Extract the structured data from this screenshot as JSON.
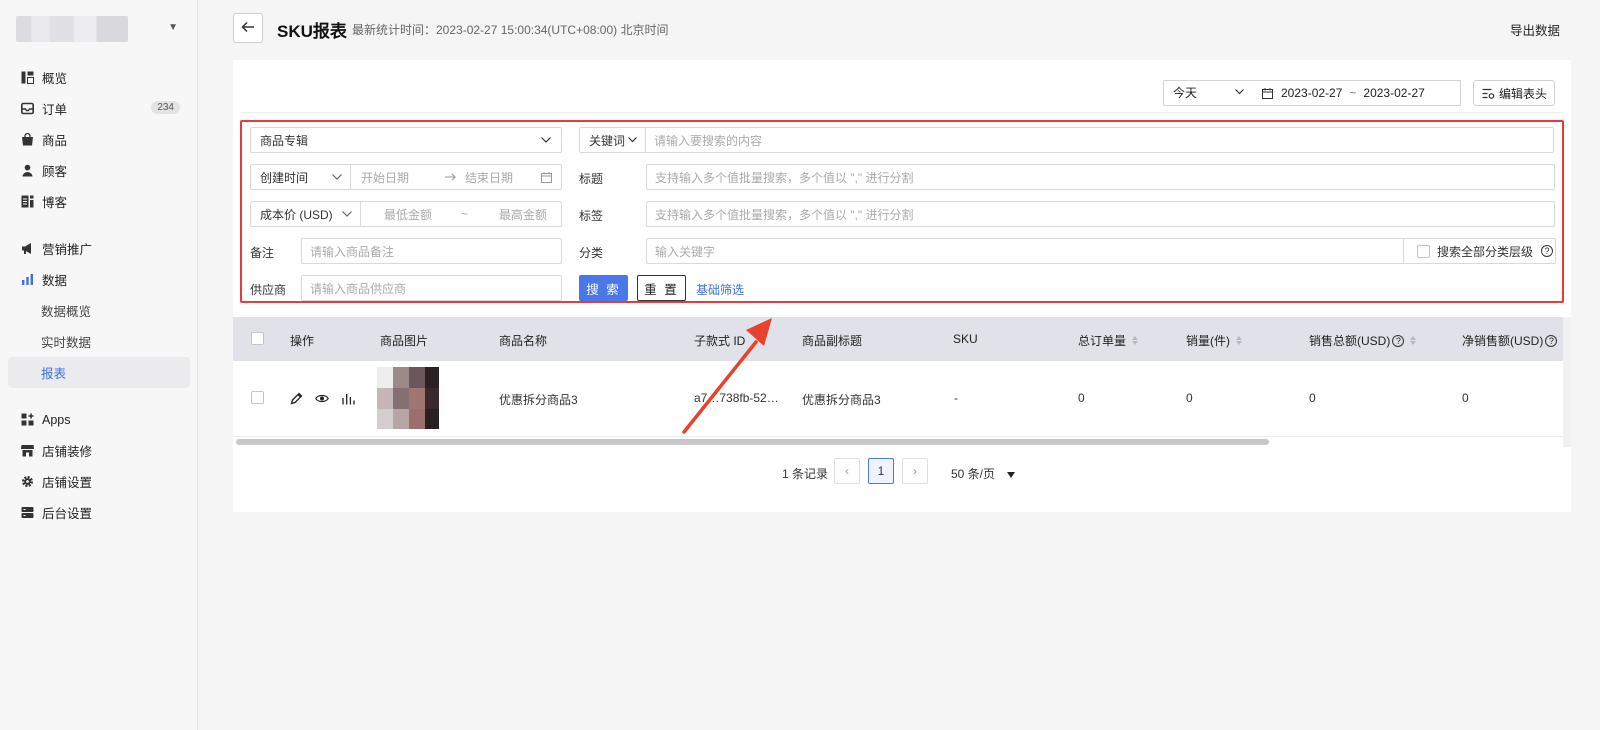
{
  "sidebar": {
    "items": [
      {
        "label": "概览",
        "icon": "overview-icon"
      },
      {
        "label": "订单",
        "icon": "orders-icon",
        "badge": "234"
      },
      {
        "label": "商品",
        "icon": "bag-icon"
      },
      {
        "label": "顾客",
        "icon": "user-icon"
      },
      {
        "label": "博客",
        "icon": "blog-icon"
      }
    ],
    "items2": [
      {
        "label": "营销推广",
        "icon": "megaphone-icon"
      },
      {
        "label": "数据",
        "icon": "bar-chart-icon"
      }
    ],
    "data_sub": [
      "数据概览",
      "实时数据",
      "报表"
    ],
    "items3": [
      {
        "label": "Apps",
        "icon": "apps-icon"
      },
      {
        "label": "店铺装修",
        "icon": "store-icon"
      },
      {
        "label": "店铺设置",
        "icon": "gear-icon"
      },
      {
        "label": "后台设置",
        "icon": "server-icon"
      }
    ]
  },
  "header": {
    "title": "SKU报表",
    "stat_time": "最新统计时间：2023-02-27 15:00:34(UTC+08:00) 北京时间",
    "export": "导出数据"
  },
  "toolbar": {
    "period": "今天",
    "date_start": "2023-02-27",
    "date_sep": "~",
    "date_end": "2023-02-27",
    "edit_columns": "编辑表头"
  },
  "filters": {
    "collection_select": "商品专辑",
    "keyword_select": "关键词",
    "keyword_placeholder": "请输入要搜索的内容",
    "created_select": "创建时间",
    "start_date_placeholder": "开始日期",
    "end_date_placeholder": "结束日期",
    "title_label": "标题",
    "title_placeholder": "支持输入多个值批量搜索，多个值以 \",\" 进行分割",
    "cost_select": "成本价 (USD)",
    "min_amount_placeholder": "最低金额",
    "amount_sep": "~",
    "max_amount_placeholder": "最高金额",
    "tag_label": "标签",
    "tag_placeholder": "支持输入多个值批量搜索，多个值以 \",\" 进行分割",
    "note_label": "备注",
    "note_placeholder": "请输入商品备注",
    "category_label": "分类",
    "category_placeholder": "输入关键字",
    "search_all_levels": "搜索全部分类层级",
    "supplier_label": "供应商",
    "supplier_placeholder": "请输入商品供应商",
    "search_button": "搜 索",
    "reset_button": "重 置",
    "basic_filter_link": "基础筛选"
  },
  "table": {
    "columns": [
      "操作",
      "商品图片",
      "商品名称",
      "子款式 ID",
      "商品副标题",
      "SKU",
      "总订单量",
      "销量(件)",
      "销售总额(USD)",
      "净销售额(USD)"
    ],
    "rows": [
      {
        "name": "优惠拆分商品3",
        "variant_id": "a7…738fb-52…",
        "subtitle": "优惠拆分商品3",
        "sku": "-",
        "orders": "0",
        "sales_qty": "0",
        "sales_total": "0",
        "net_sales": "0"
      }
    ]
  },
  "pagination": {
    "total": "1 条记录",
    "current_page": "1",
    "page_size": "50 条/页"
  },
  "colors": {
    "accent": "#4a78e8",
    "highlight_box": "#e83a3a",
    "arrow": "#e8412d"
  }
}
